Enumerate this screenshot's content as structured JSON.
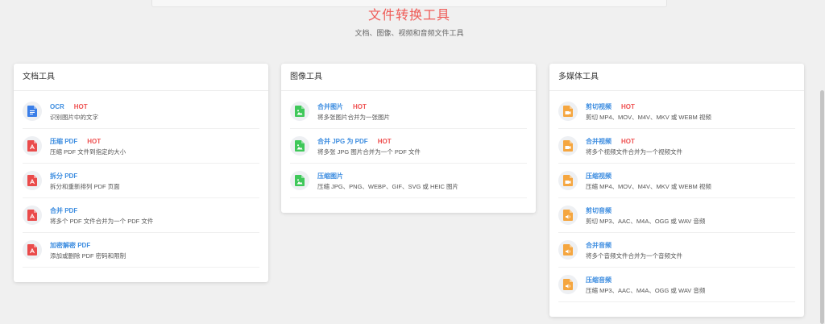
{
  "header": {
    "title": "文件转换工具",
    "subtitle": "文档、图像、视频和音频文件工具"
  },
  "colors": {
    "title": "#ef5a56",
    "link": "#3d8de0",
    "hot": "#ef5252",
    "doc": "#3a7ee8",
    "pdf": "#ea4b4b",
    "image": "#3fc85a",
    "media": "#f5a640"
  },
  "cards": [
    {
      "title": "文档工具",
      "tools": [
        {
          "name": "OCR",
          "hot": "HOT",
          "desc": "识别图片中的文字",
          "icon": "doc-icon"
        },
        {
          "name": "压缩 PDF",
          "hot": "HOT",
          "desc": "压缩 PDF 文件到指定的大小",
          "icon": "pdf-icon"
        },
        {
          "name": "拆分 PDF",
          "hot": "",
          "desc": "拆分和重新排列 PDF 页面",
          "icon": "pdf-icon"
        },
        {
          "name": "合并 PDF",
          "hot": "",
          "desc": "将多个 PDF 文件合并为一个 PDF 文件",
          "icon": "pdf-icon"
        },
        {
          "name": "加密解密 PDF",
          "hot": "",
          "desc": "添加或删除 PDF 密码和限制",
          "icon": "pdf-icon"
        }
      ]
    },
    {
      "title": "图像工具",
      "tools": [
        {
          "name": "合并图片",
          "hot": "HOT",
          "desc": "将多张图片合并为一张图片",
          "icon": "image-icon"
        },
        {
          "name": "合并 JPG 为 PDF",
          "hot": "HOT",
          "desc": "将多张 JPG 图片合并为一个 PDF 文件",
          "icon": "image-icon"
        },
        {
          "name": "压缩图片",
          "hot": "",
          "desc": "压缩 JPG、PNG、WEBP、GIF、SVG 或 HEIC 图片",
          "icon": "image-icon"
        }
      ]
    },
    {
      "title": "多媒体工具",
      "tools": [
        {
          "name": "剪切视频",
          "hot": "HOT",
          "desc": "剪切 MP4、MOV、M4V、MKV 或 WEBM 视频",
          "icon": "video-icon"
        },
        {
          "name": "合并视频",
          "hot": "HOT",
          "desc": "将多个视频文件合并为一个视频文件",
          "icon": "video-icon"
        },
        {
          "name": "压缩视频",
          "hot": "",
          "desc": "压缩 MP4、MOV、M4V、MKV 或 WEBM 视频",
          "icon": "video-icon"
        },
        {
          "name": "剪切音频",
          "hot": "",
          "desc": "剪切 MP3、AAC、M4A、OGG 或 WAV 音频",
          "icon": "audio-icon"
        },
        {
          "name": "合并音频",
          "hot": "",
          "desc": "将多个音频文件合并为一个音频文件",
          "icon": "audio-icon"
        },
        {
          "name": "压缩音频",
          "hot": "",
          "desc": "压缩 MP3、AAC、M4A、OGG 或 WAV 音频",
          "icon": "audio-icon"
        }
      ]
    }
  ]
}
